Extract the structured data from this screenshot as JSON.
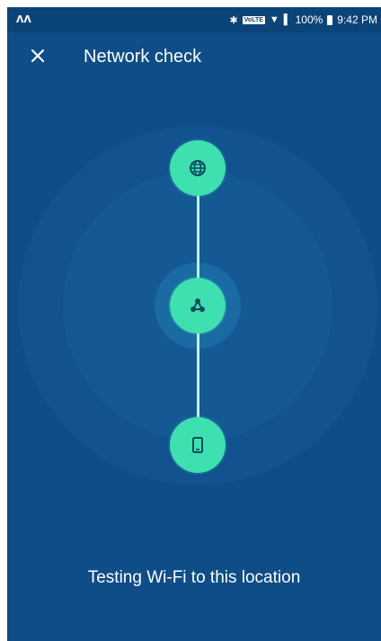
{
  "status_bar": {
    "carrier_glyph": "ʌʌ",
    "volte_label": "VoLTE",
    "battery": "100%",
    "time": "9:42 PM"
  },
  "app_bar": {
    "close_icon": "close-icon",
    "title": "Network check"
  },
  "diagram": {
    "nodes": [
      {
        "icon": "globe-icon"
      },
      {
        "icon": "router-hub-icon"
      },
      {
        "icon": "phone-icon"
      }
    ]
  },
  "status_text": "Testing Wi-Fi to this location",
  "colors": {
    "background": "#0e4d88",
    "node": "#3fe0b0",
    "icon": "#0d4a62",
    "line": "#bdf5e0"
  }
}
